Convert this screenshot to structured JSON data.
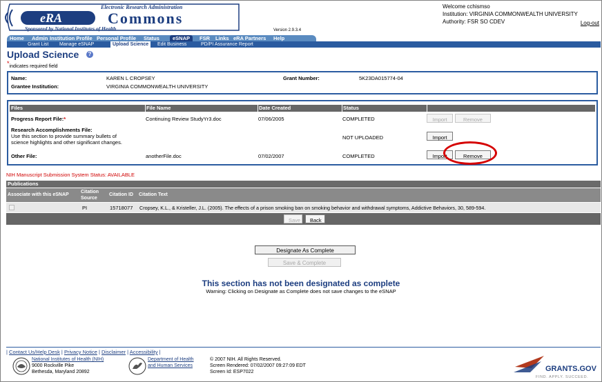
{
  "header": {
    "logo_top": "Electronic Research Administration",
    "logo_era": "eRA",
    "logo_commons": "Commons",
    "logo_bottom": "Sponsored by National Institutes of Health",
    "version": "Version 2.9.3.4",
    "welcome": "Welcome cchismso",
    "institution": "Institution: VIRGINIA COMMONWEALTH UNIVERSITY",
    "authority": "Authority:  FSR SO CDEV",
    "logout": "Log-out"
  },
  "nav": {
    "primary": [
      "Home",
      "Admin",
      "Institution Profile",
      "Personal Profile",
      "Status",
      "eSNAP",
      "FSR",
      "Links",
      "eRA Partners",
      "Help"
    ],
    "secondary": [
      "Grant List",
      "Manage eSNAP",
      "Upload Science",
      "Edit Business",
      "PD/PI Assurance Report"
    ]
  },
  "page": {
    "title": "Upload Science",
    "required_note": "indicates required field"
  },
  "info": {
    "name_label": "Name:",
    "name_value": "KAREN L CROPSEY",
    "institution_label": "Grantee Institution:",
    "institution_value": "VIRGINIA COMMONWEALTH UNIVERSITY",
    "grant_label": "Grant Number:",
    "grant_value": "5K23DA015774-04"
  },
  "files": {
    "headers": [
      "Files",
      "File Name",
      "Date Created",
      "Status"
    ],
    "rows": [
      {
        "label": "Progress Report File:",
        "required": "*",
        "file": "Continuing Review StudyYr3.doc",
        "date": "07/06/2005",
        "status": "COMPLETED",
        "import": "Import",
        "remove": "Remove"
      },
      {
        "label": "Research Accomplishments File:",
        "desc1": "Use this section to provide summary bullets of",
        "desc2": "science highlights and other significant changes.",
        "file": "",
        "date": "",
        "status": "NOT UPLOADED",
        "import": "Import"
      },
      {
        "label": "Other File:",
        "file": "anotherFile.doc",
        "date": "07/02/2007",
        "status": "COMPLETED",
        "import": "Import",
        "remove": "Remove"
      }
    ]
  },
  "nih_status": "NIH Manuscript Submission System Status: AVAILABLE",
  "publications": {
    "title": "Publications",
    "headers": {
      "associate": "Associate with this eSNAP",
      "source1": "Citation",
      "source2": "Source",
      "citation_id": "Citation ID",
      "citation_text": "Citation Text"
    },
    "rows": [
      {
        "source": "PI",
        "id": "15718077",
        "text": "Cropsey, K.L., & Kristeller, J.L. (2005). The effects of a prison smoking ban on smoking behavior and withdrawal symptoms, Addictive Behaviors, 30, 589-594."
      }
    ],
    "save": "Save",
    "back": "Back"
  },
  "designate": {
    "button": "Designate As Complete",
    "save_complete": "Save & Complete",
    "title": "This section has not been designated as complete",
    "warning": "Warning: Clicking on Designate as Complete does not save changes to the eSNAP"
  },
  "footer": {
    "links": [
      "Contact Us/Help Desk",
      "Privacy Notice",
      "Disclaimer",
      "Accessibility"
    ],
    "nih_name": "National Institutes of Health (NIH)",
    "nih_addr1": "9000 Rockville Pike",
    "nih_addr2": "Bethesda, Maryland 20892",
    "hhs1": "Department of Health",
    "hhs2": "and Human Services",
    "copyright": "© 2007 NIH. All Rights Reserved.",
    "rendered": "Screen Rendered: 07/02/2007 09:27:09 EDT",
    "screen_id": "Screen Id: ESP7022",
    "grants_logo": "GRANTS.GOV",
    "grants_tag": "FIND. APPLY. SUCCEED."
  },
  "colors": {
    "nav_blue": "#2a5ba0",
    "title_blue": "#1d3e80",
    "required_red": "#d00000",
    "highlight_circle": "#d50000"
  }
}
